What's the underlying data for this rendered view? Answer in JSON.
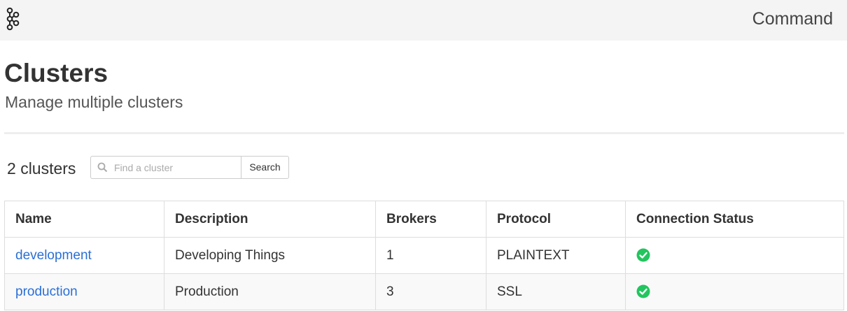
{
  "header": {
    "app_name": "Command",
    "logo_icon": "kafka-logo-icon"
  },
  "page": {
    "title": "Clusters",
    "subtitle": "Manage multiple clusters"
  },
  "toolbar": {
    "count": "2",
    "count_label": "clusters",
    "search_placeholder": "Find a cluster",
    "search_value": "",
    "search_button": "Search"
  },
  "table": {
    "columns": [
      "Name",
      "Description",
      "Brokers",
      "Protocol",
      "Connection Status"
    ],
    "rows": [
      {
        "name": "development",
        "description": "Developing Things",
        "brokers": "1",
        "protocol": "PLAINTEXT",
        "status": "connected"
      },
      {
        "name": "production",
        "description": "Production",
        "brokers": "3",
        "protocol": "SSL",
        "status": "connected"
      }
    ]
  },
  "colors": {
    "link": "#2a6fd6",
    "status_ok": "#22c55e",
    "topbar_bg": "#f4f4f4"
  }
}
